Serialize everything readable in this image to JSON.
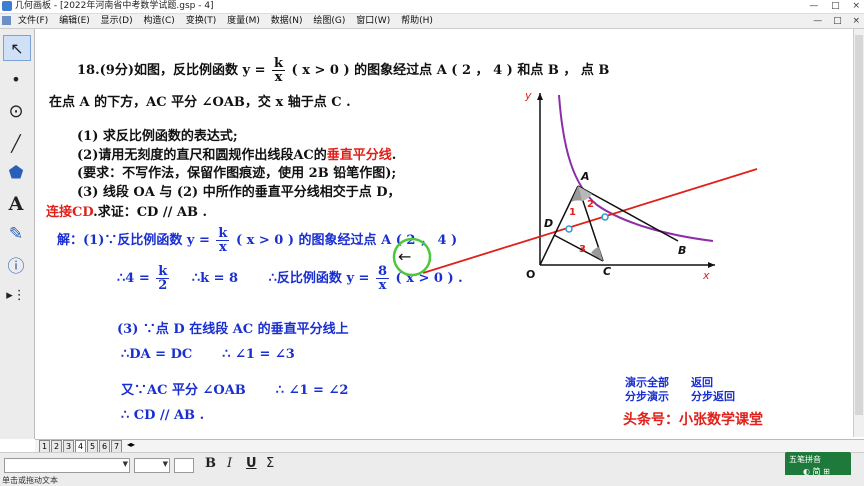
{
  "window": {
    "title": "几何画板 - [2022年河南省中考数学试题.gsp - 4]",
    "controls": [
      "—",
      "□",
      "×"
    ]
  },
  "menu": {
    "items": [
      "文件(F)",
      "编辑(E)",
      "显示(D)",
      "构造(C)",
      "变换(T)",
      "度量(M)",
      "数据(N)",
      "绘图(G)",
      "窗口(W)",
      "帮助(H)"
    ],
    "controls": [
      "—",
      "□",
      "×"
    ]
  },
  "toolbox": {
    "tools": [
      {
        "name": "selection-arrow-tool",
        "glyph": "↖"
      },
      {
        "name": "point-tool",
        "glyph": "•"
      },
      {
        "name": "compass-tool",
        "glyph": "⊙"
      },
      {
        "name": "straightedge-tool",
        "glyph": "╱"
      },
      {
        "name": "polygon-tool",
        "glyph": "⬟"
      },
      {
        "name": "text-tool",
        "glyph": "A"
      },
      {
        "name": "marker-tool",
        "glyph": "✎"
      },
      {
        "name": "information-tool",
        "glyph": "ⓘ"
      },
      {
        "name": "custom-tools",
        "glyph": "▸⋮"
      }
    ]
  },
  "problem": {
    "l1_a": "18.(9分)如图，反比例函数 y =",
    "l1_num": "k",
    "l1_den": "x",
    "l1_b": "( x > 0 ) 的图象经过点 A ( 2 ， 4 ) 和点 B ， 点 B",
    "l2": "在点 A 的下方，AC 平分 ∠OAB，交 x 轴于点 C .",
    "l3": "(1) 求反比例函数的表达式;",
    "l4_a": "(2)请用无刻度的直尺和圆规作出线段AC的",
    "l4_red": "垂直平分线",
    "l4_b": ".",
    "l5": "(要求：不写作法，保留作图痕迹，使用 2B 铅笔作图);",
    "l6": "(3) 线段 OA 与 (2) 中所作的垂直平分线相交于点 D，",
    "l7_red": "连接CD",
    "l7_b": ".求证：CD // AB ."
  },
  "solution": {
    "s1_a": "解：(1)∵反比例函数 y =",
    "s1_num": "k",
    "s1_den": "x",
    "s1_b": "( x > 0 ) 的图象经过点 A ( 2 ， 4 )",
    "s2_a": "∴4 =",
    "s2_num": "k",
    "s2_den": "2",
    "s2_b": "∴k = 8",
    "s2_c": "∴反比例函数 y =",
    "s2_num2": "8",
    "s2_den2": "x",
    "s2_d": "( x > 0 ) .",
    "s3": "(3) ∵点 D 在线段 AC 的垂直平分线上",
    "s4_a": "∴DA = DC",
    "s4_b": "∴ ∠1 = ∠3",
    "s5_a": "又∵AC 平分 ∠OAB",
    "s5_b": "∴ ∠1 = ∠2",
    "s6": "∴ CD // AB ."
  },
  "controls": {
    "show_all": "演示全部",
    "back": "返回",
    "step": "分步演示",
    "step_back": "分步返回"
  },
  "credit": "头条号：小张数学课堂",
  "figure": {
    "labels": {
      "y": "y",
      "x": "x",
      "O": "O",
      "A": "A",
      "B": "B",
      "C": "C",
      "D": "D",
      "a1": "1",
      "a2": "2",
      "a3": "3"
    }
  },
  "page_tabs": [
    "1",
    "2",
    "3",
    "4",
    "5",
    "6",
    "7"
  ],
  "active_tab": "4",
  "format_bar": {
    "bold": "B",
    "italic": "I",
    "underline": "U",
    "symbol": "Σ"
  },
  "status": "单击或拖动文本",
  "ime": {
    "name": "五笔拼音",
    "row2": "◐ 简 ⊞"
  },
  "colors": {
    "text_black": "#111111",
    "text_blue": "#1a2fd0",
    "accent_red": "#e0201a",
    "curve_purple": "#8b2fa8",
    "perp_line": "#e0201a"
  }
}
